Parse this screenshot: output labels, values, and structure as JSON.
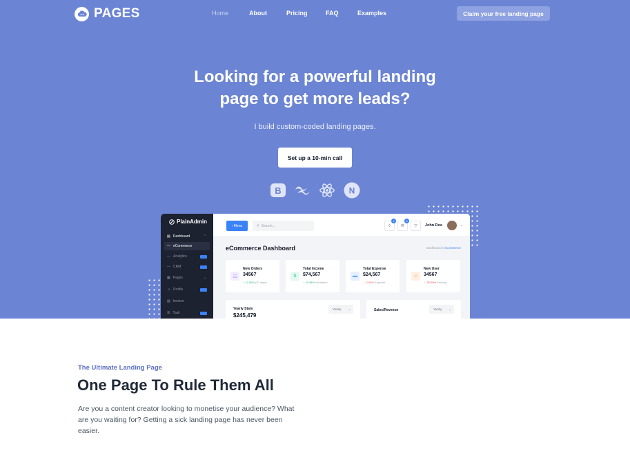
{
  "brand": {
    "name": "PAGES",
    "icon": "cloud-logo-icon"
  },
  "nav": {
    "items": [
      {
        "label": "Home",
        "active": true
      },
      {
        "label": "About"
      },
      {
        "label": "Pricing"
      },
      {
        "label": "FAQ"
      },
      {
        "label": "Examples"
      }
    ],
    "cta_label": "Claim your free landing page"
  },
  "hero": {
    "headline_line1": "Looking for a powerful landing",
    "headline_line2": "page to get more leads?",
    "subheadline": "I build custom-coded landing pages.",
    "cta_label": "Set up a 10-min call",
    "background_color": "#6b84d4",
    "tech_icons": [
      "bootstrap-icon",
      "tailwind-icon",
      "react-icon",
      "nextjs-icon"
    ]
  },
  "dashboard_preview": {
    "brand": "PlainAdmin",
    "sidebar": [
      {
        "label": "Dashboard",
        "icon": "grid-icon"
      },
      {
        "label": "eCommerce"
      },
      {
        "label": "Analytics",
        "badge": "Pro"
      },
      {
        "label": "CRM",
        "badge": "Pro"
      },
      {
        "label": "Pages",
        "icon": "pages-icon"
      },
      {
        "label": "Profile",
        "icon": "user-icon",
        "badge": "Pro"
      },
      {
        "label": "Invoice",
        "icon": "invoice-icon"
      },
      {
        "label": "Task",
        "icon": "task-icon",
        "badge": "Pro"
      }
    ],
    "menu_label": "Menu",
    "search_placeholder": "Search...",
    "notification_count": "2",
    "message_count": "3",
    "user_name": "John Doe",
    "title": "eCommerce Dashboard",
    "breadcrumb": [
      "Dashboard",
      "eCommerce"
    ],
    "stats": [
      {
        "label": "New Orders",
        "value": "34567",
        "change": "+2.00%",
        "note": "(30 days)",
        "direction": "up",
        "icon": "cart-icon",
        "color": "#a78bfa"
      },
      {
        "label": "Total Income",
        "value": "$74,567",
        "change": "+5.45%",
        "note": "Increased",
        "direction": "up",
        "icon": "dollar-icon",
        "color": "#34d399"
      },
      {
        "label": "Total Expense",
        "value": "$24,567",
        "change": "-2.00%",
        "note": "Expense",
        "direction": "down",
        "icon": "card-icon",
        "color": "#60a5fa"
      },
      {
        "label": "New User",
        "value": "34567",
        "change": "-25.00%",
        "note": "Earning",
        "direction": "down",
        "icon": "user-icon",
        "color": "#fb923c"
      }
    ],
    "panels": [
      {
        "title": "Yearly Stats",
        "value": "$245,479",
        "select": "Yearly"
      },
      {
        "title": "Sales/Revenue",
        "value": "",
        "select": "Yearly"
      }
    ]
  },
  "section": {
    "eyebrow": "The Ultimate Landing Page",
    "title": "One Page To Rule Them All",
    "body": "Are you a content creator looking to monetise your audience? What are you waiting for? Getting a sick landing page has never been easier."
  }
}
